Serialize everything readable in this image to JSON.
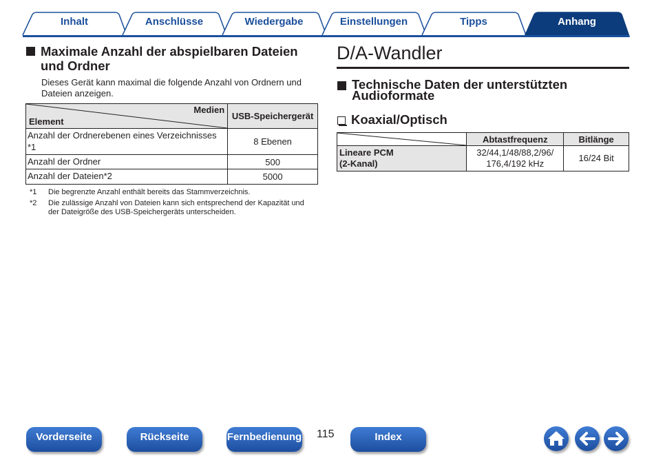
{
  "tabs": [
    {
      "label": "Inhalt",
      "active": false
    },
    {
      "label": "Anschlüsse",
      "active": false
    },
    {
      "label": "Wiedergabe",
      "active": false
    },
    {
      "label": "Einstellungen",
      "active": false
    },
    {
      "label": "Tipps",
      "active": false
    },
    {
      "label": "Anhang",
      "active": true
    }
  ],
  "colors": {
    "accent": "#1b4f9c",
    "active_tab": "#0c3c7c",
    "table_header": "#e5e5e5"
  },
  "left": {
    "heading_line1": "Maximale Anzahl der abspielbaren Dateien",
    "heading_line2": "und Ordner",
    "intro_line1": "Dieses Gerät kann maximal die folgende Anzahl von Ordnern und",
    "intro_line2": "Dateien anzeigen.",
    "table": {
      "corner_top": "Medien",
      "corner_bottom": "Element",
      "col_header": "USB-Speichergerät",
      "rows": [
        {
          "label_line1": "Anzahl der Ordnerebenen eines Verzeichnisses",
          "label_line2": "*1",
          "value": "8 Ebenen"
        },
        {
          "label_line1": "Anzahl der Ordner",
          "value": "500"
        },
        {
          "label_line1": "Anzahl der Dateien*2",
          "value": "5000"
        }
      ]
    },
    "notes": [
      {
        "mark": "*1",
        "line1": "Die begrenzte Anzahl enthält bereits das Stammverzeichnis."
      },
      {
        "mark": "*2",
        "line1": "Die zulässige Anzahl von Dateien kann sich entsprechend der Kapazität und",
        "line2": "der Dateigröße des USB-Speichergeräts unterscheiden."
      }
    ]
  },
  "right": {
    "title": "D/A-Wandler",
    "heading_line1": "Technische Daten der unterstützten",
    "heading_line2": "Audioformate",
    "subheading": "Koaxial/Optisch",
    "table": {
      "col1": "Abtastfrequenz",
      "col2": "Bitlänge",
      "row_label_line1": "Lineare PCM",
      "row_label_line2": "(2-Kanal)",
      "freq_line1": "32/44,1/48/88,2/96/",
      "freq_line2": "176,4/192 kHz",
      "bits": "16/24 Bit"
    }
  },
  "footer": {
    "buttons": [
      "Vorderseite",
      "Rückseite",
      "Fernbedienung",
      "Index"
    ],
    "page_number": "115",
    "icons": [
      "home-icon",
      "arrow-left-icon",
      "arrow-right-icon"
    ]
  }
}
